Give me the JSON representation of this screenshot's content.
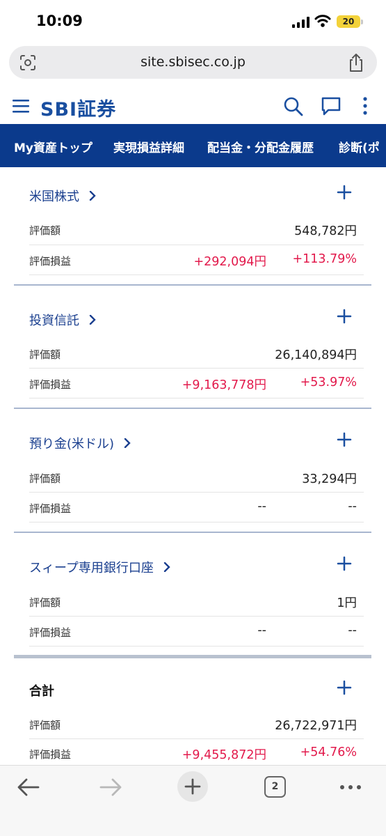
{
  "status_bar": {
    "time": "10:09",
    "battery": "20"
  },
  "browser": {
    "url": "site.sbisec.co.jp",
    "open_tabs": "2"
  },
  "site": {
    "logo_text": "SBI証券"
  },
  "nav": [
    "My資産トップ",
    "実現損益詳細",
    "配当金・分配金履歴",
    "診断(ポ"
  ],
  "sections": [
    {
      "title": "米国株式",
      "label_value": "評価額",
      "value": "548,782円",
      "label_pl": "評価損益",
      "pl": "+292,094円",
      "pl_pct": "+113.79%"
    },
    {
      "title": "投資信託",
      "label_value": "評価額",
      "value": "26,140,894円",
      "label_pl": "評価損益",
      "pl": "+9,163,778円",
      "pl_pct": "+53.97%"
    },
    {
      "title": "預り金(米ドル)",
      "label_value": "評価額",
      "value": "33,294円",
      "label_pl": "評価損益",
      "pl": "--",
      "pl_pct": "--"
    },
    {
      "title": "スィープ専用銀行口座",
      "label_value": "評価額",
      "value": "1円",
      "label_pl": "評価損益",
      "pl": "--",
      "pl_pct": "--"
    }
  ],
  "total": {
    "title": "合計",
    "label_value": "評価額",
    "value": "26,722,971円",
    "label_pl": "評価損益",
    "pl": "+9,455,872円",
    "pl_pct": "+54.76%"
  },
  "colors": {
    "brand_blue": "#1a4fa0",
    "nav_bg": "#0b3a8c",
    "positive_red": "#e2194b"
  }
}
